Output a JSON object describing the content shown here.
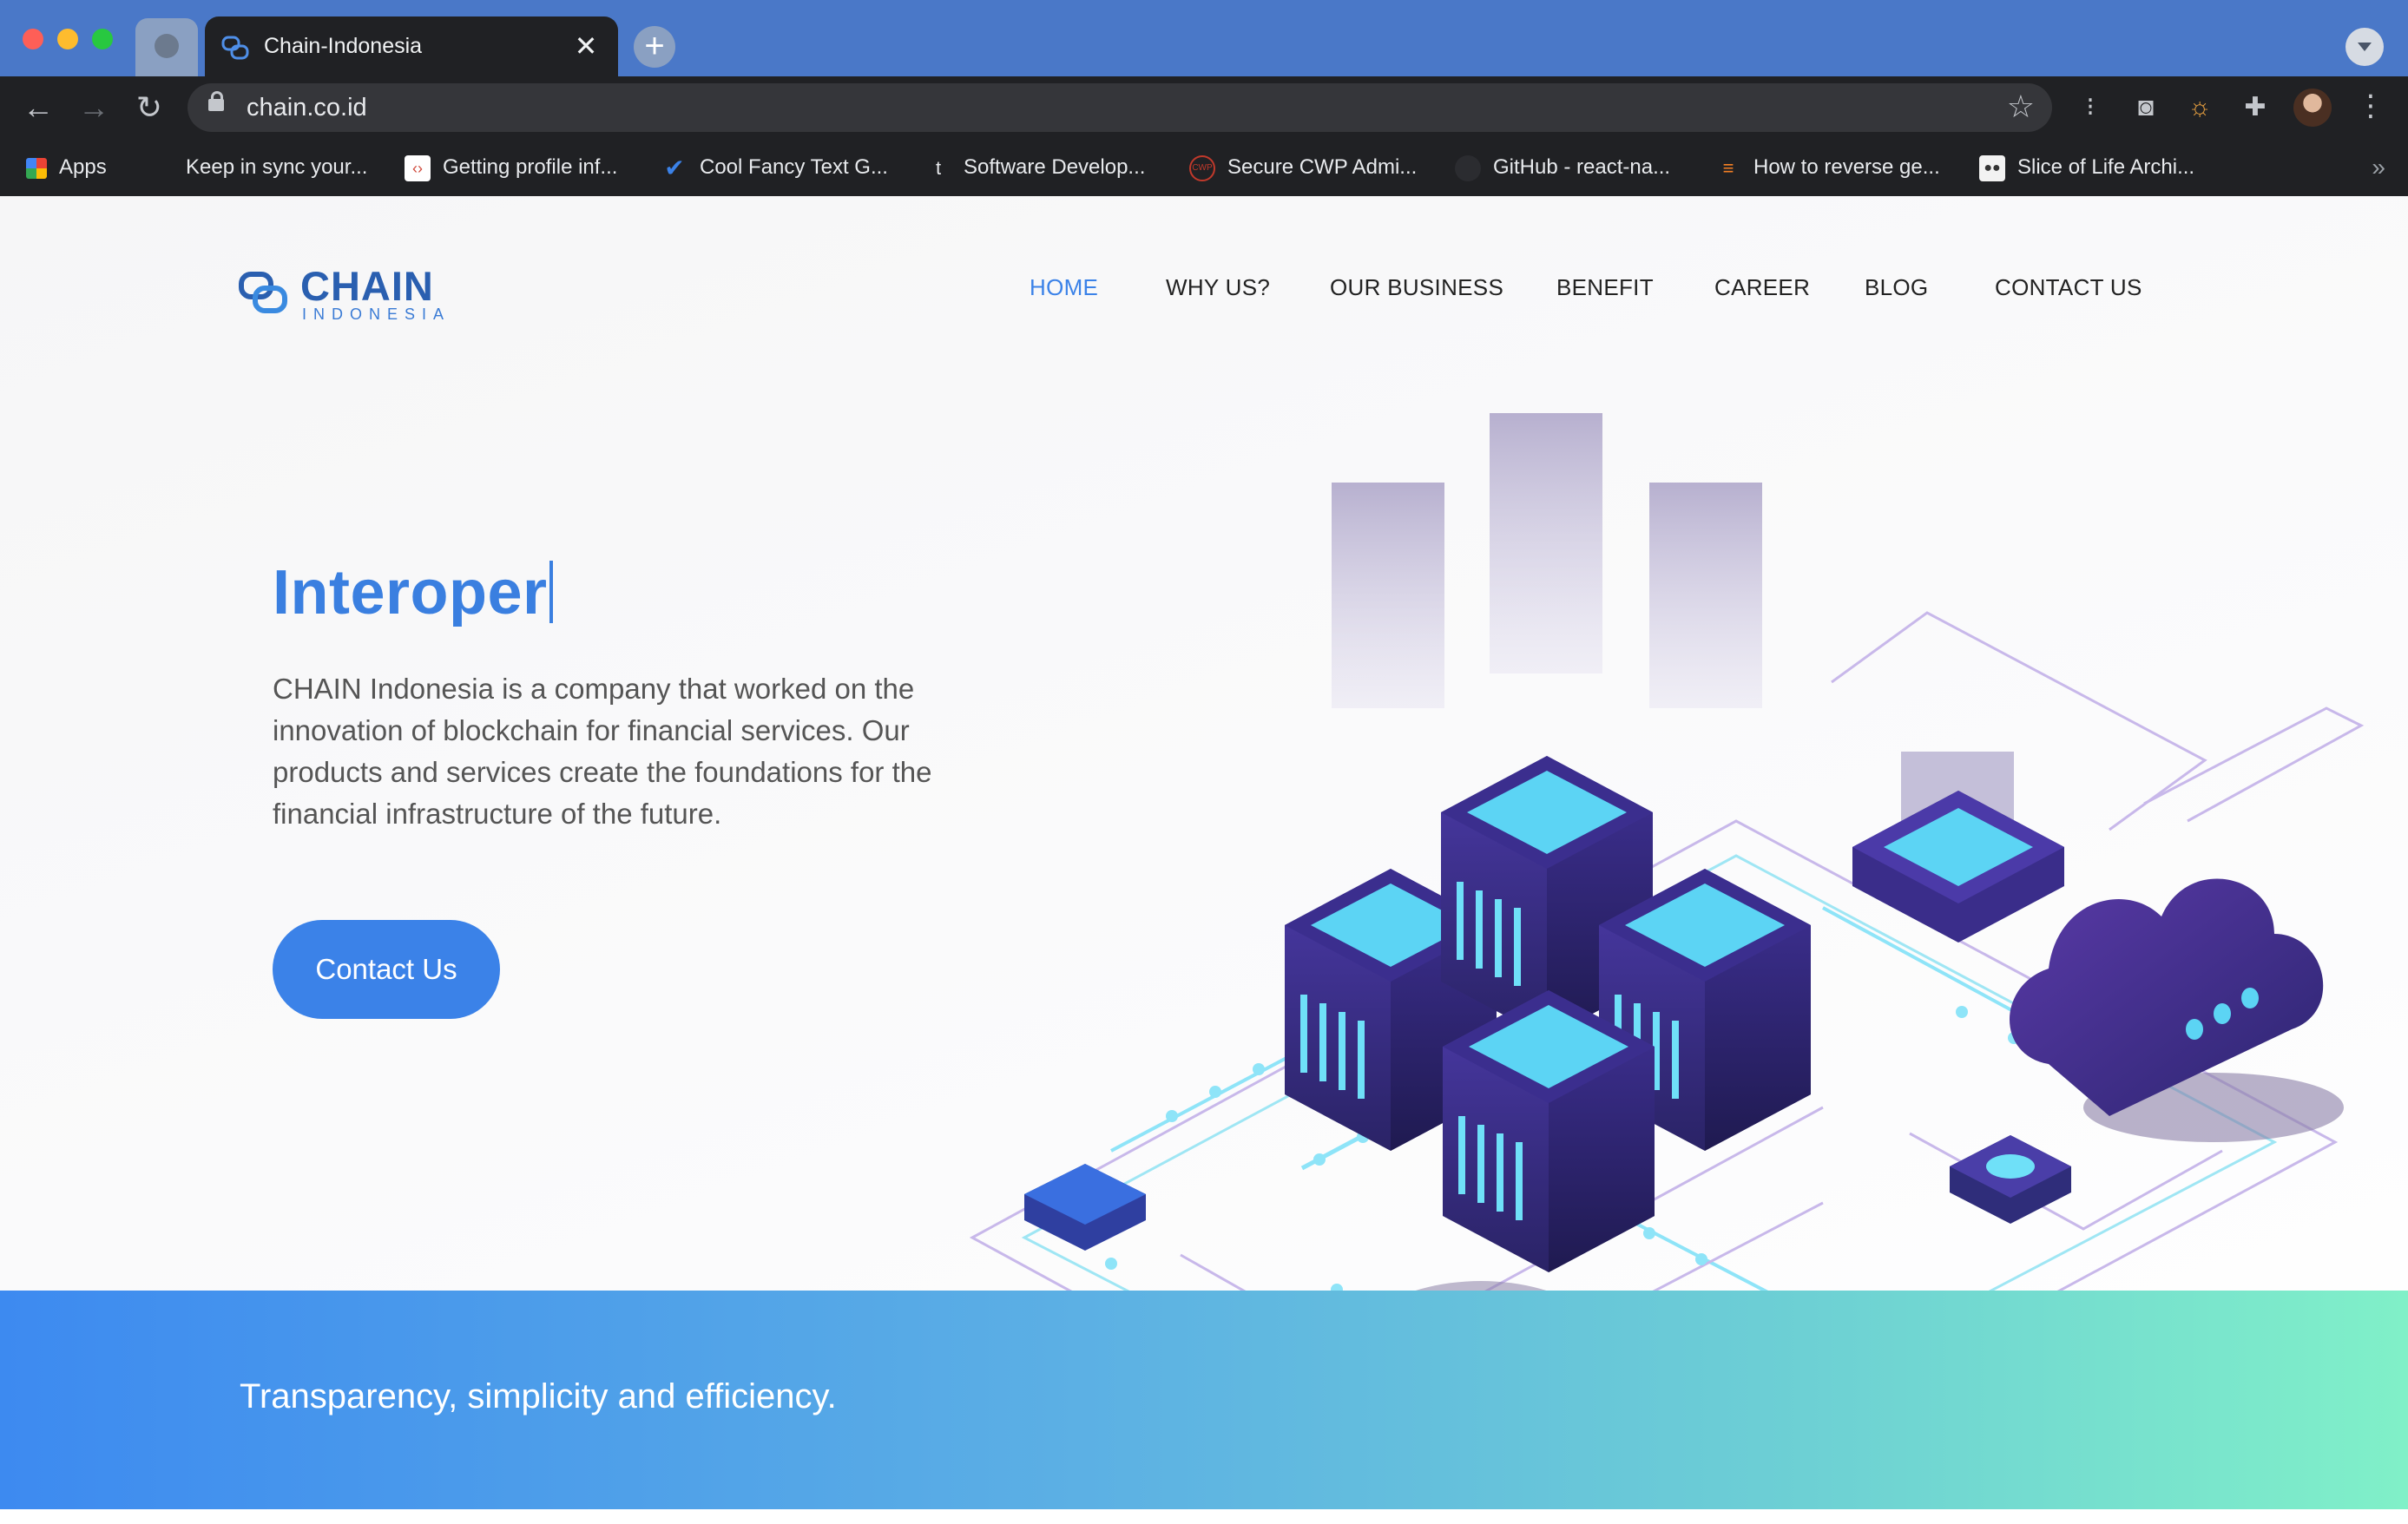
{
  "browser": {
    "tab_title": "Chain-Indonesia",
    "tab_close": "✕",
    "new_tab": "+",
    "url": "chain.co.id",
    "bookmarks": [
      {
        "label": "Apps"
      },
      {
        "label": "Keep in sync your..."
      },
      {
        "label": "Getting profile inf..."
      },
      {
        "label": "Cool Fancy Text G..."
      },
      {
        "label": "Software Develop..."
      },
      {
        "label": "Secure CWP Admi..."
      },
      {
        "label": "GitHub - react-na..."
      },
      {
        "label": "How to reverse ge..."
      },
      {
        "label": "Slice of Life Archi..."
      }
    ],
    "bookmarks_overflow": "»"
  },
  "site": {
    "logo_word": "CHAIN",
    "logo_sub": "INDONESIA",
    "nav": [
      {
        "label": "HOME",
        "active": true
      },
      {
        "label": "WHY US?"
      },
      {
        "label": "OUR BUSINESS"
      },
      {
        "label": "BENEFIT"
      },
      {
        "label": "CAREER"
      },
      {
        "label": "BLOG"
      },
      {
        "label": "CONTACT US"
      }
    ],
    "hero": {
      "title": "Interoper",
      "description": "CHAIN Indonesia is a company that worked on the innovation of blockchain for financial services. Our products and services create the foundations for the financial infrastructure of the future.",
      "cta": "Contact Us"
    },
    "band_text": "Transparency, simplicity and efficiency."
  },
  "colors": {
    "accent": "#3b82e8",
    "tabstrip": "#4a78c8",
    "toolbar": "#202124",
    "band_start": "#3d8af0",
    "band_end": "#80f0c8"
  },
  "icons": [
    "globe-icon",
    "chain-favicon-icon",
    "close-icon",
    "plus-icon",
    "back-icon",
    "forward-icon",
    "reload-icon",
    "lock-icon",
    "star-icon",
    "extension-icon",
    "camera-icon",
    "puzzle-icon",
    "apps-grid-icon"
  ]
}
